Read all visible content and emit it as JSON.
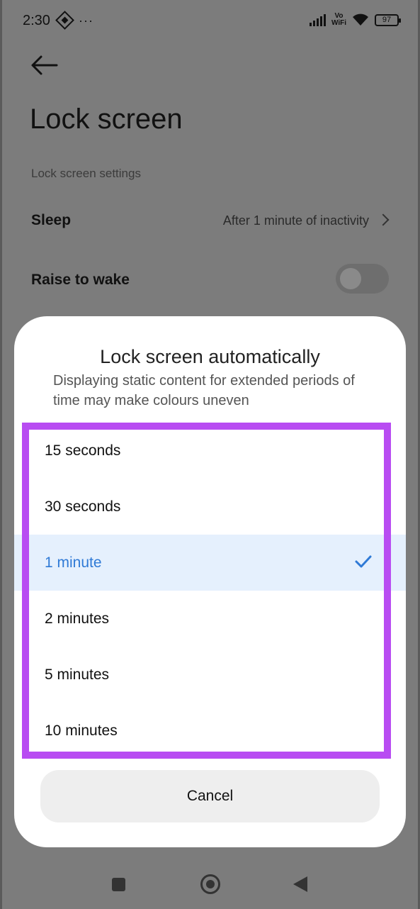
{
  "status_bar": {
    "time": "2:30",
    "more_dots": "···",
    "vo": "Vo",
    "wifi": "WiFi",
    "battery": "97"
  },
  "header": {
    "title": "Lock screen"
  },
  "settings": {
    "section_label": "Lock screen settings",
    "sleep_label": "Sleep",
    "sleep_value": "After 1 minute of inactivity",
    "raise_to_wake_label": "Raise to wake",
    "raise_to_wake_on": false
  },
  "dialog": {
    "title": "Lock screen automatically",
    "subtitle": "Displaying static content for extended periods of time may make colours uneven",
    "options": [
      {
        "label": "15 seconds",
        "selected": false
      },
      {
        "label": "30 seconds",
        "selected": false
      },
      {
        "label": "1 minute",
        "selected": true
      },
      {
        "label": "2 minutes",
        "selected": false
      },
      {
        "label": "5 minutes",
        "selected": false
      },
      {
        "label": "10 minutes",
        "selected": false
      }
    ],
    "cancel_label": "Cancel"
  },
  "colors": {
    "accent": "#2f7ad6",
    "selected_bg": "#e5f0fd",
    "highlight": "#b84cf2"
  },
  "icons": {
    "back": "arrow-left-icon",
    "chevron": "chevron-right-icon",
    "check": "check-icon",
    "nav_recents": "square-icon",
    "nav_home": "home-circle-icon",
    "nav_back": "triangle-back-icon"
  }
}
